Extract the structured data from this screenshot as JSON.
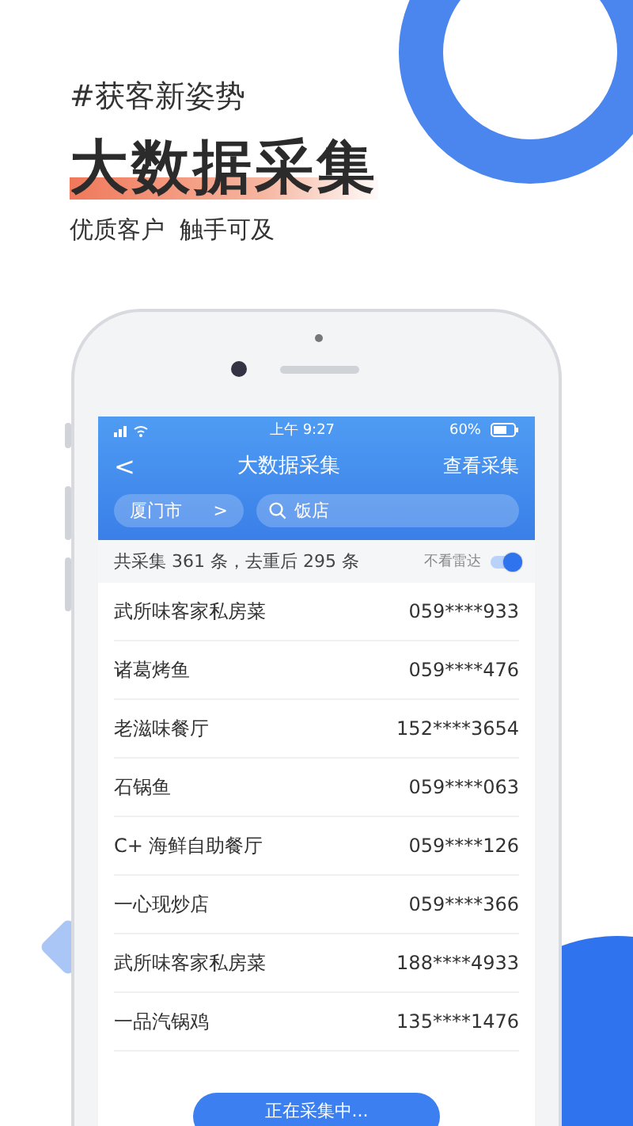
{
  "promo": {
    "tagline": "#获客新姿势",
    "headline": "大数据采集",
    "subline": "优质客户  触手可及"
  },
  "status_bar": {
    "time": "上午 9:27",
    "battery": "60%"
  },
  "nav": {
    "back": "<",
    "title": "大数据采集",
    "action": "查看采集"
  },
  "filter": {
    "city": "厦门市",
    "city_arrow": ">",
    "search_value": "饭店"
  },
  "summary": {
    "text": "共采集 361 条，去重后 295 条",
    "toggle_label": "不看雷达",
    "toggle_on": true
  },
  "rows": [
    {
      "name": "武所味客家私房菜",
      "phone": "059****933"
    },
    {
      "name": "诸葛烤鱼",
      "phone": "059****476"
    },
    {
      "name": "老滋味餐厅",
      "phone": "152****3654"
    },
    {
      "name": "石锅鱼",
      "phone": "059****063"
    },
    {
      "name": "C+ 海鲜自助餐厅",
      "phone": "059****126"
    },
    {
      "name": "一心现炒店",
      "phone": "059****366"
    },
    {
      "name": "武所味客家私房菜",
      "phone": "188****4933"
    },
    {
      "name": "一品汽锅鸡",
      "phone": "135****1476"
    }
  ],
  "bottom_button": "正在采集中..."
}
